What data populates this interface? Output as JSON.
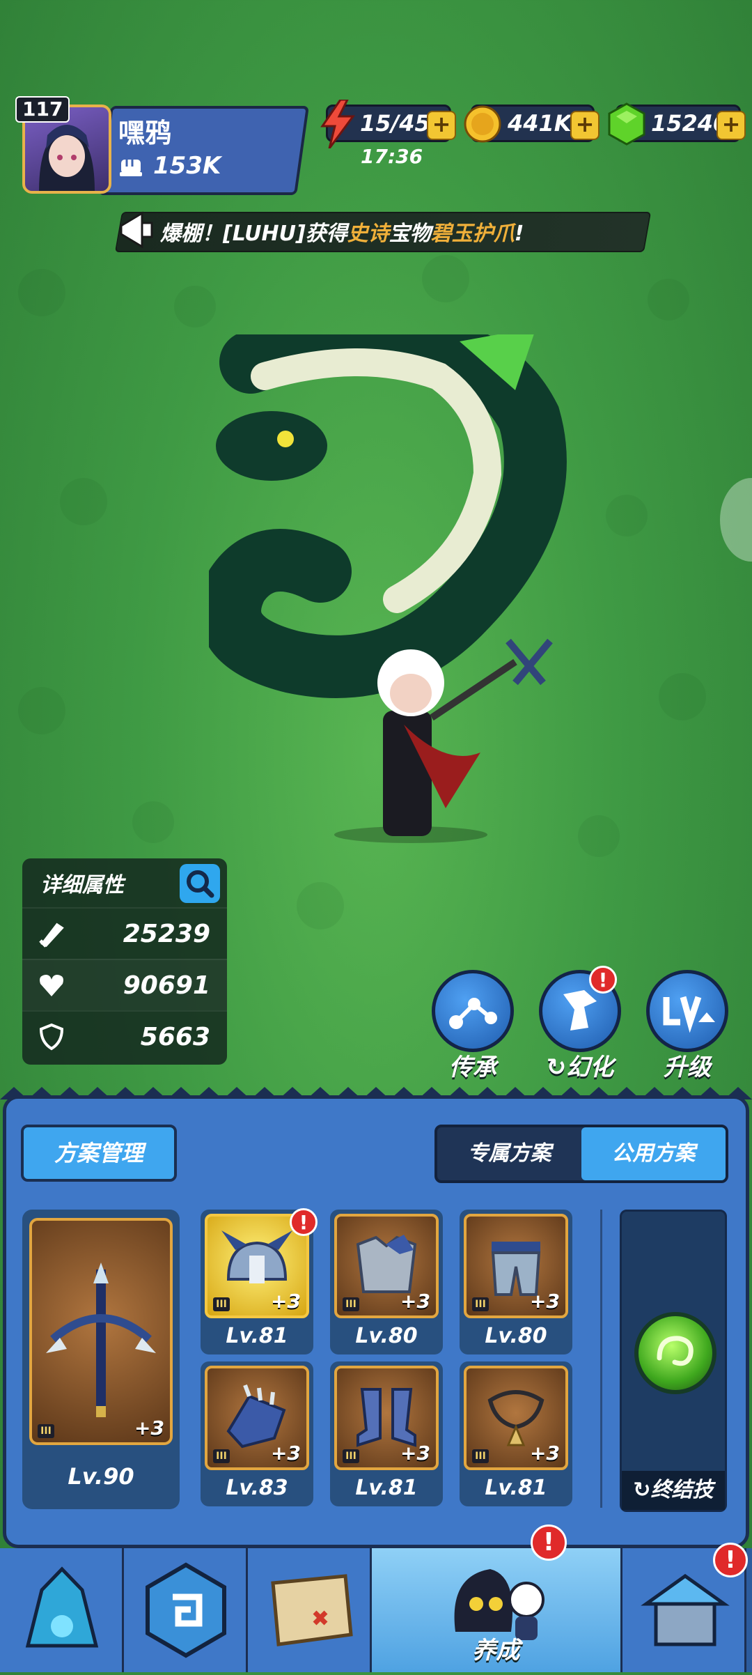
{
  "player": {
    "level": "117",
    "name": "嘿鸦",
    "power": "153K"
  },
  "resources": {
    "energy": "15/45",
    "energy_timer": "17:36",
    "coins": "441K",
    "gems": "15240",
    "plus": "+"
  },
  "broadcast": {
    "prefix": "爆棚！[LUHU]获得",
    "rarity": "史诗",
    "middle": "宝物",
    "item": "碧玉护爪",
    "suffix": "!"
  },
  "stats": {
    "title": "详细属性",
    "attack": "25239",
    "hp": "90691",
    "defense": "5663"
  },
  "actions": {
    "inherit": "传承",
    "transform": "幻化",
    "upgrade": "升级",
    "alert": "!"
  },
  "plans": {
    "manage": "方案管理",
    "tab_exclusive": "专属方案",
    "tab_public": "公用方案",
    "tier": "III"
  },
  "weapon": {
    "bonus": "+3",
    "level": "Lv.90"
  },
  "gear": [
    {
      "bonus": "+3",
      "level": "Lv.81"
    },
    {
      "bonus": "+3",
      "level": "Lv.80"
    },
    {
      "bonus": "+3",
      "level": "Lv.80"
    },
    {
      "bonus": "+3",
      "level": "Lv.83"
    },
    {
      "bonus": "+3",
      "level": "Lv.81"
    },
    {
      "bonus": "+3",
      "level": "Lv.81"
    }
  ],
  "ultimate": {
    "label": "终结技"
  },
  "nav": {
    "active_label": "养成"
  },
  "colors": {
    "panel": "#3f78c8",
    "accent": "#3fa6ef",
    "gold": "#f0b03a",
    "alert": "#e02a2a"
  }
}
